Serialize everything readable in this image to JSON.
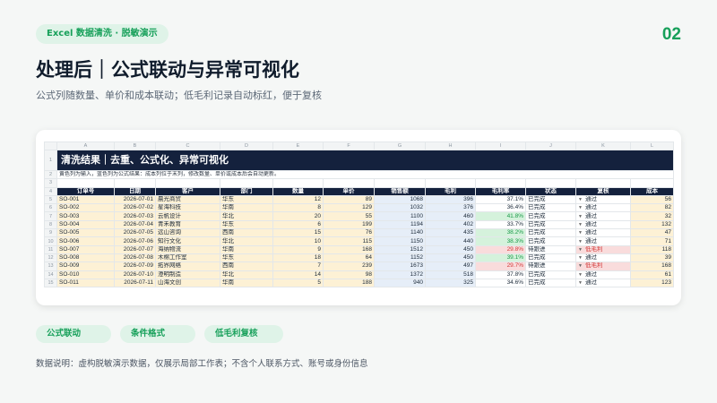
{
  "header": {
    "tag": "Excel 数据清洗 · 脱敏演示",
    "page_number": "02",
    "title": "处理后｜公式联动与异常可视化",
    "subtitle": "公式列随数量、单价和成本联动；低毛利记录自动标红，便于复核"
  },
  "sheet": {
    "column_letters": [
      "A",
      "B",
      "C",
      "D",
      "E",
      "F",
      "G",
      "H",
      "I",
      "J",
      "K",
      "L"
    ],
    "banner": "清洗结果｜去重、公式化、异常可视化",
    "note": "黄色列为输入，蓝色列为公式结果：成本列位于末列，修改数量、单价或成本后会自动更新。",
    "headers": [
      "订单号",
      "日期",
      "客户",
      "部门",
      "数量",
      "单价",
      "销售额",
      "毛利",
      "毛利率",
      "状态",
      "复核",
      "成本"
    ],
    "rows": [
      {
        "rn": "5",
        "id": "SO-001",
        "date": "2026-07-01",
        "customer": "晨光商贸",
        "dept": "华东",
        "qty": "12",
        "price": "89",
        "sales": "1068",
        "profit": "396",
        "margin": "37.1%",
        "status": "已完成",
        "review": "通过",
        "cost": "56",
        "mclass": "mg"
      },
      {
        "rn": "6",
        "id": "SO-002",
        "date": "2026-07-02",
        "customer": "星海科技",
        "dept": "华南",
        "qty": "8",
        "price": "129",
        "sales": "1032",
        "profit": "376",
        "margin": "36.4%",
        "status": "已完成",
        "review": "通过",
        "cost": "82",
        "mclass": "mg"
      },
      {
        "rn": "7",
        "id": "SO-003",
        "date": "2026-07-03",
        "customer": "云帆设计",
        "dept": "华北",
        "qty": "20",
        "price": "55",
        "sales": "1100",
        "profit": "460",
        "margin": "41.8%",
        "status": "已完成",
        "review": "通过",
        "cost": "32",
        "mclass": "mg-ok"
      },
      {
        "rn": "8",
        "id": "SO-004",
        "date": "2026-07-04",
        "customer": "青禾教育",
        "dept": "华东",
        "qty": "6",
        "price": "199",
        "sales": "1194",
        "profit": "402",
        "margin": "33.7%",
        "status": "已完成",
        "review": "通过",
        "cost": "132",
        "mclass": "mg"
      },
      {
        "rn": "9",
        "id": "SO-005",
        "date": "2026-07-05",
        "customer": "远山咨询",
        "dept": "西南",
        "qty": "15",
        "price": "76",
        "sales": "1140",
        "profit": "435",
        "margin": "38.2%",
        "status": "已完成",
        "review": "通过",
        "cost": "47",
        "mclass": "mg-ok"
      },
      {
        "rn": "10",
        "id": "SO-006",
        "date": "2026-07-06",
        "customer": "知行文化",
        "dept": "华北",
        "qty": "10",
        "price": "115",
        "sales": "1150",
        "profit": "440",
        "margin": "38.3%",
        "status": "已完成",
        "review": "通过",
        "cost": "71",
        "mclass": "mg-ok"
      },
      {
        "rn": "11",
        "id": "SO-007",
        "date": "2026-07-07",
        "customer": "海纳物流",
        "dept": "华南",
        "qty": "9",
        "price": "168",
        "sales": "1512",
        "profit": "450",
        "margin": "29.8%",
        "status": "待跟进",
        "review": "低毛利",
        "cost": "118",
        "mclass": "mg-bad"
      },
      {
        "rn": "12",
        "id": "SO-008",
        "date": "2026-07-08",
        "customer": "木棉工作室",
        "dept": "华东",
        "qty": "18",
        "price": "64",
        "sales": "1152",
        "profit": "450",
        "margin": "39.1%",
        "status": "已完成",
        "review": "通过",
        "cost": "39",
        "mclass": "mg-ok"
      },
      {
        "rn": "13",
        "id": "SO-009",
        "date": "2026-07-09",
        "customer": "拓界网络",
        "dept": "西南",
        "qty": "7",
        "price": "239",
        "sales": "1673",
        "profit": "497",
        "margin": "29.7%",
        "status": "待跟进",
        "review": "低毛利",
        "cost": "168",
        "mclass": "mg-bad"
      },
      {
        "rn": "14",
        "id": "SO-010",
        "date": "2026-07-10",
        "customer": "澄明制造",
        "dept": "华北",
        "qty": "14",
        "price": "98",
        "sales": "1372",
        "profit": "518",
        "margin": "37.8%",
        "status": "已完成",
        "review": "通过",
        "cost": "61",
        "mclass": "mg"
      },
      {
        "rn": "15",
        "id": "SO-011",
        "date": "2026-07-11",
        "customer": "山海文创",
        "dept": "华南",
        "qty": "5",
        "price": "188",
        "sales": "940",
        "profit": "325",
        "margin": "34.6%",
        "status": "已完成",
        "review": "通过",
        "cost": "123",
        "mclass": "mg"
      }
    ]
  },
  "chips": [
    "公式联动",
    "条件格式",
    "低毛利复核"
  ],
  "footnote": "数据说明：虚构脱敏演示数据，仅展示局部工作表；不含个人联系方式、账号或身份信息",
  "colors": {
    "accent": "#17a05a",
    "chip_bg": "#dff3e8",
    "header_navy": "#14213d",
    "input_yellow": "#fdf1d5",
    "formula_blue": "#e6eef8",
    "ok_green": "#d5f2dc",
    "bad_red": "#f9dcdc"
  }
}
